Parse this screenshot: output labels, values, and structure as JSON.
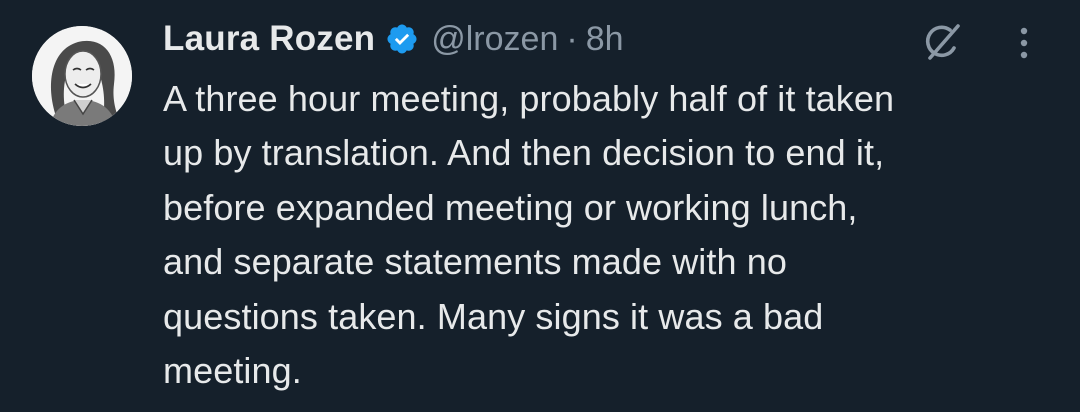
{
  "author": {
    "name": "Laura Rozen",
    "handle": "@lrozen",
    "separator": "·",
    "time": "8h",
    "verified": true,
    "verified_color": "#1d9bf0"
  },
  "tweet": {
    "text": "A three hour meeting, probably half of it taken\nup by translation. And then decision to end it,\nbefore expanded meeting or working lunch,\nand separate statements made with no\nquestions taken. Many signs it was a bad\nmeeting."
  },
  "icons": {
    "verified": "verified-badge-icon",
    "grok": "grok-icon",
    "more": "more-options-icon"
  },
  "colors": {
    "background": "#15202b",
    "text_primary": "#e7e9ea",
    "text_secondary": "#8b98a5"
  }
}
